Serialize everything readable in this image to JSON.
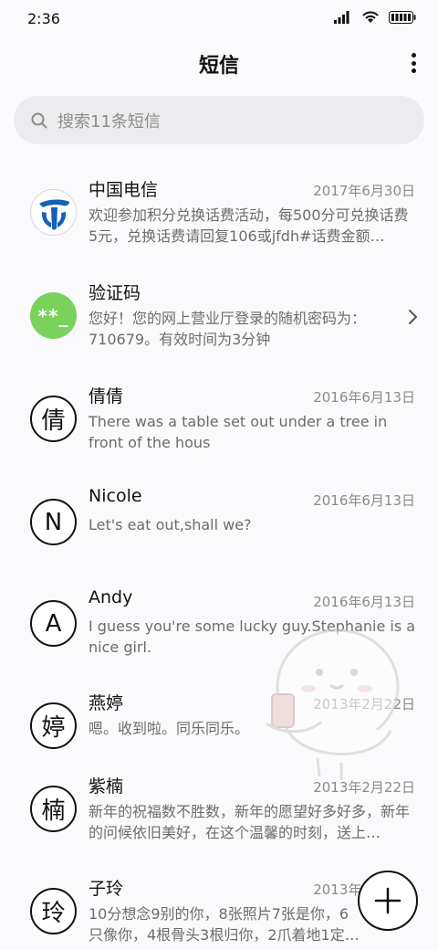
{
  "status_bar": {
    "time": "2:36"
  },
  "header": {
    "title": "短信"
  },
  "search": {
    "placeholder": "搜索11条短信"
  },
  "conversations": [
    {
      "name": "中国电信",
      "date": "2017年6月30日",
      "preview": "欢迎参加积分兑换话费活动，每500分可兑换话费5元，兑换话费请回复106或jfdh#话费金额…",
      "avatar_type": "telecom-logo"
    },
    {
      "name": "验证码",
      "date": "",
      "preview": "您好！您的网上营业厅登录的随机密码为：710679。有效时间为3分钟",
      "avatar_text": "**_"
    },
    {
      "name": "倩倩",
      "date": "2016年6月13日",
      "preview": "There was a table set out under a tree in front of the hous",
      "avatar_text": "倩"
    },
    {
      "name": "Nicole",
      "date": "2016年6月13日",
      "preview": "Let's eat out,shall we?",
      "avatar_text": "N"
    },
    {
      "name": "Andy",
      "date": "2016年6月13日",
      "preview": "I guess you're some lucky guy.Stephanie is a nice girl.",
      "avatar_text": "A"
    },
    {
      "name": "燕婷",
      "date": "2013年2月22日",
      "preview": "嗯。收到啦。同乐同乐。",
      "avatar_text": "婷"
    },
    {
      "name": "紫楠",
      "date": "2013年2月22日",
      "preview": "新年的祝福数不胜数，新年的愿望好多好多，新年的问候依旧美好，在这个温馨的时刻，送上…",
      "avatar_text": "楠"
    },
    {
      "name": "子玲",
      "date": "2013年2月23日",
      "preview": "10分想念9别的你，8张照片7张是你，6只像你，4根骨头3根归你，2爪着地1定是…",
      "avatar_text": "玲"
    }
  ],
  "colors": {
    "accent_green": "#78d25c",
    "telecom_blue": "#1560b8"
  },
  "icons": {
    "search": "search-icon",
    "more": "more-vertical-icon",
    "compose": "plus-icon",
    "chevron": "chevron-right-icon"
  }
}
